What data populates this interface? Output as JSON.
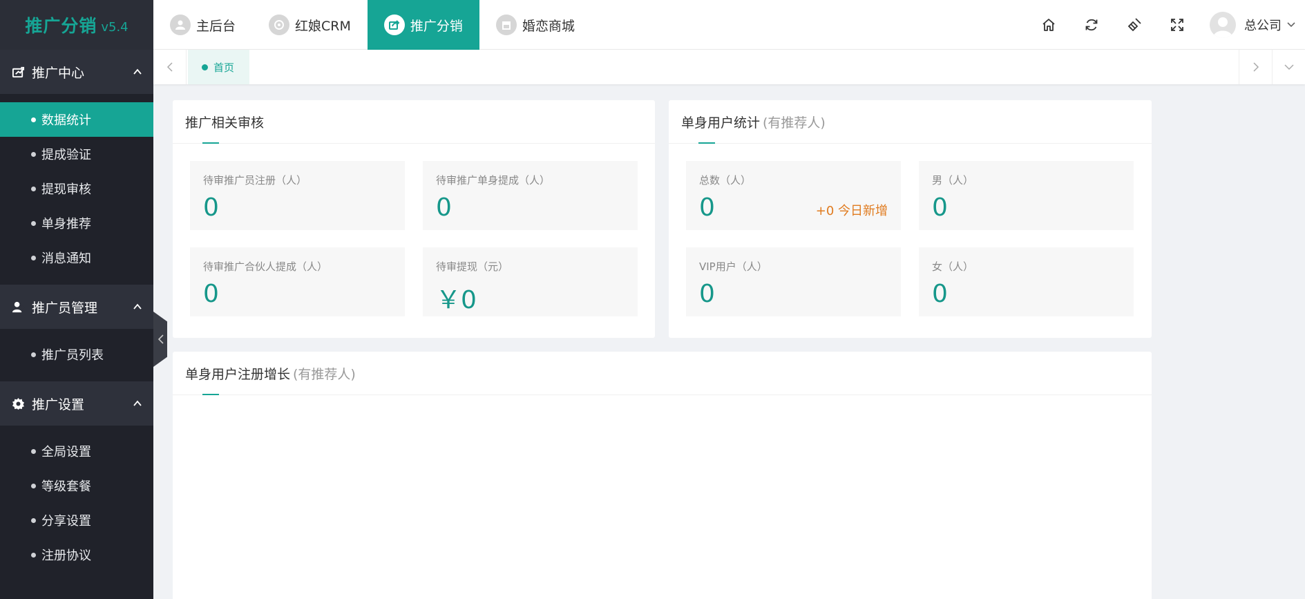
{
  "colors": {
    "accent": "#16a595",
    "sidebar_bg": "#20222a",
    "highlight_orange": "#e07b1f"
  },
  "logo": {
    "title": "推广分销",
    "version": "v5.4"
  },
  "sidebar": {
    "groups": [
      {
        "label": "推广中心",
        "icon": "chart-share-icon",
        "items": [
          "数据统计",
          "提成验证",
          "提现审核",
          "单身推荐",
          "消息通知"
        ]
      },
      {
        "label": "推广员管理",
        "icon": "user-manage-icon",
        "items": [
          "推广员列表"
        ]
      },
      {
        "label": "推广设置",
        "icon": "gear-icon",
        "items": [
          "全局设置",
          "等级套餐",
          "分享设置",
          "注册协议"
        ]
      }
    ],
    "active_item": "数据统计"
  },
  "topnav": {
    "items": [
      "主后台",
      "红娘CRM",
      "推广分销",
      "婚恋商城"
    ],
    "active": "推广分销"
  },
  "tools": [
    "home-icon",
    "refresh-icon",
    "clear-icon",
    "fullscreen-icon"
  ],
  "user": {
    "name": "总公司"
  },
  "tabs": {
    "home": "首页"
  },
  "review_card": {
    "title": "推广相关审核",
    "stats": [
      {
        "label": "待审推广员注册（人）",
        "value": "0"
      },
      {
        "label": "待审推广单身提成（人）",
        "value": "0"
      },
      {
        "label": "待审推广合伙人提成（人）",
        "value": "0"
      },
      {
        "label": "待审提现（元）",
        "value": "￥0"
      }
    ]
  },
  "user_stats_card": {
    "title": "单身用户统计",
    "subtitle": "(有推荐人)",
    "stats": [
      {
        "label": "总数（人）",
        "value": "0",
        "extra": "+0 今日新增"
      },
      {
        "label": "男（人）",
        "value": "0"
      },
      {
        "label": "VIP用户（人）",
        "value": "0"
      },
      {
        "label": "女（人）",
        "value": "0"
      }
    ]
  },
  "growth_card": {
    "title": "单身用户注册增长",
    "subtitle": "(有推荐人)"
  }
}
